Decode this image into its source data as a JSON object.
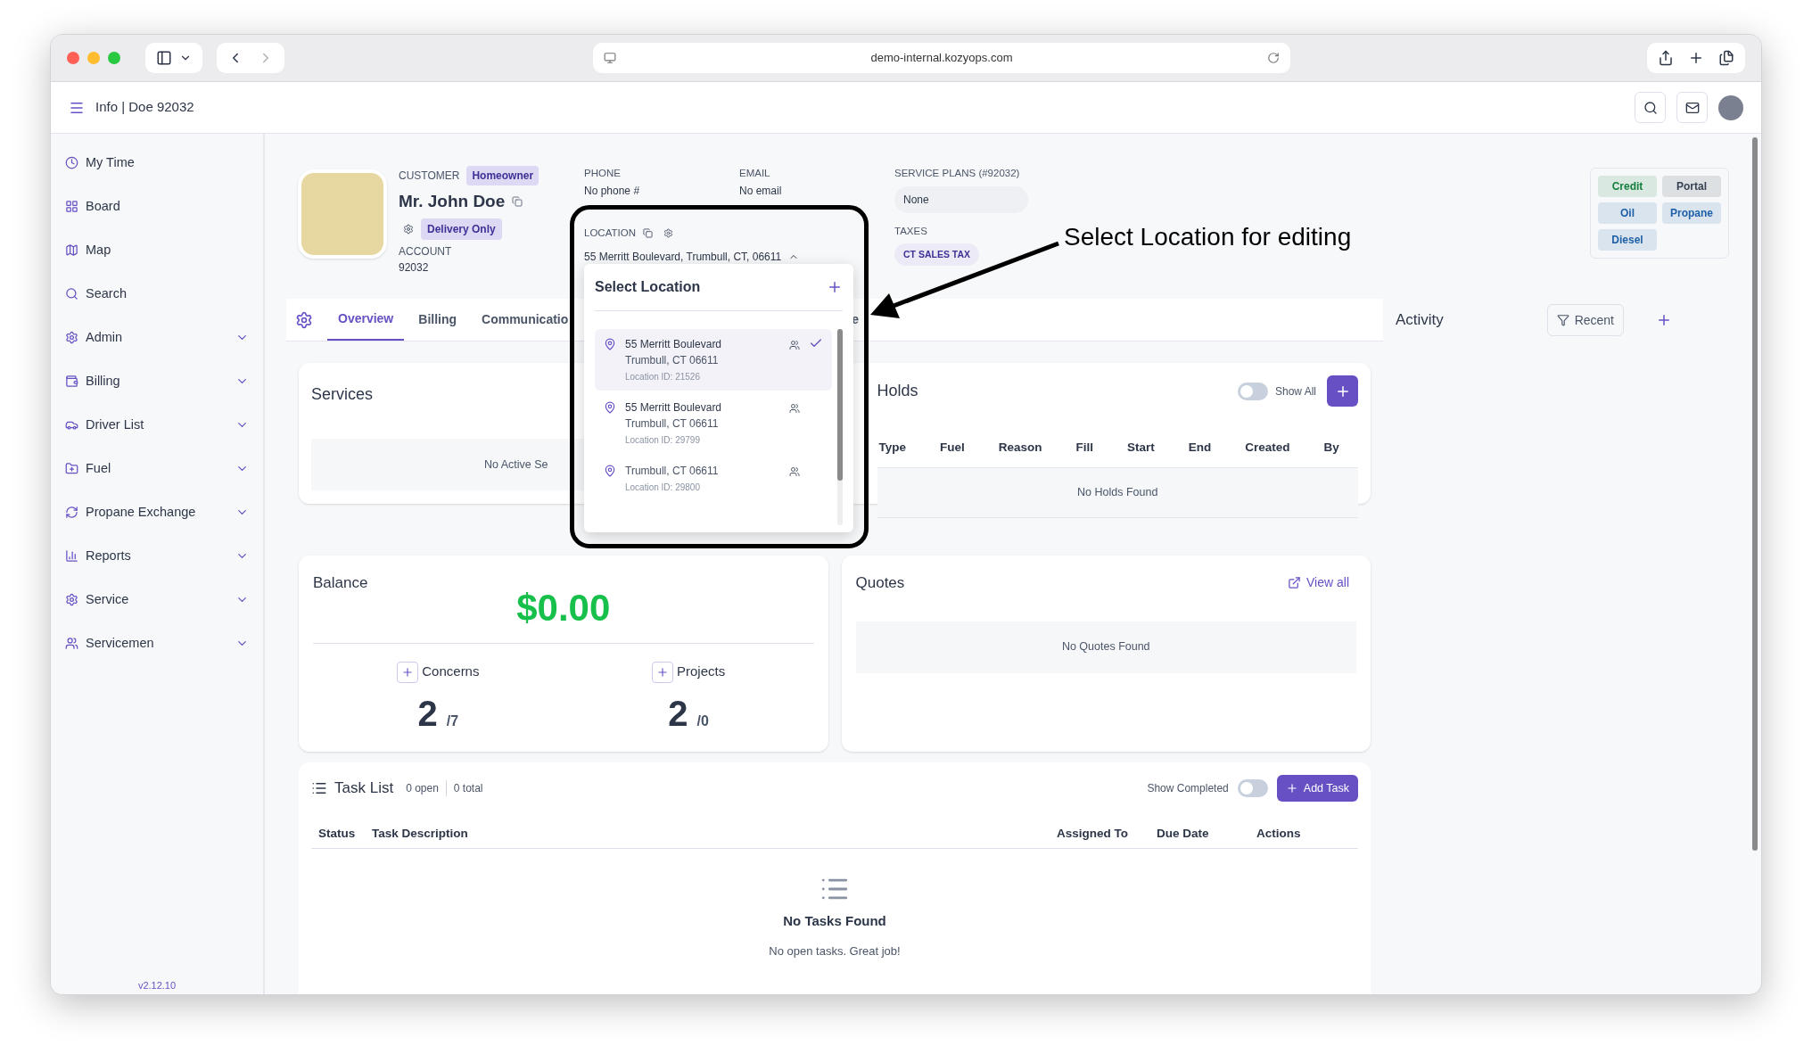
{
  "browser": {
    "url": "demo-internal.kozyops.com"
  },
  "header": {
    "title": "Info | Doe 92032"
  },
  "sidebar": {
    "items": [
      {
        "label": "My Time",
        "has_submenu": false
      },
      {
        "label": "Board",
        "has_submenu": false
      },
      {
        "label": "Map",
        "has_submenu": false
      },
      {
        "label": "Search",
        "has_submenu": false
      },
      {
        "label": "Admin",
        "has_submenu": true
      },
      {
        "label": "Billing",
        "has_submenu": true
      },
      {
        "label": "Driver List",
        "has_submenu": true
      },
      {
        "label": "Fuel",
        "has_submenu": true
      },
      {
        "label": "Propane Exchange",
        "has_submenu": true
      },
      {
        "label": "Reports",
        "has_submenu": true
      },
      {
        "label": "Service",
        "has_submenu": true
      },
      {
        "label": "Servicemen",
        "has_submenu": true
      }
    ],
    "version": "v2.12.10"
  },
  "customer": {
    "label": "CUSTOMER",
    "type_badge": "Homeowner",
    "name": "Mr. John Doe",
    "delivery_badge": "Delivery Only",
    "account_label": "ACCOUNT",
    "account": "92032"
  },
  "phone": {
    "label": "PHONE",
    "value": "No phone #"
  },
  "email": {
    "label": "EMAIL",
    "value": "No email"
  },
  "location": {
    "label": "LOCATION",
    "address": "55 Merritt Boulevard, Trumbull, CT, 06611",
    "expanded": true
  },
  "service_plans": {
    "label": "SERVICE PLANS (#92032)",
    "value": "None"
  },
  "taxes": {
    "label": "TAXES",
    "tags": [
      "CT SALES TAX"
    ]
  },
  "account_tags": [
    {
      "label": "Credit",
      "color": "#15803d"
    },
    {
      "label": "Portal",
      "color": "#374151"
    },
    {
      "label": "Oil",
      "color": "#1e60a8"
    },
    {
      "label": "Propane",
      "color": "#1e60a8"
    },
    {
      "label": "Diesel",
      "color": "#1e60a8"
    }
  ],
  "tabs": [
    {
      "label": "Overview",
      "selected": true
    },
    {
      "label": "Billing",
      "selected": false
    },
    {
      "label": "Communicatio",
      "selected": false
    },
    {
      "label": "e",
      "selected": false
    }
  ],
  "location_dropdown": {
    "title": "Select Location",
    "items": [
      {
        "street": "55 Merritt Boulevard",
        "city": "Trumbull, CT 06611",
        "id": "Location ID: 21526",
        "selected": true
      },
      {
        "street": "55 Merritt Boulevard",
        "city": "Trumbull, CT 06611",
        "id": "Location ID: 29799",
        "selected": false
      },
      {
        "city": "Trumbull, CT 06611",
        "id": "Location ID: 29800",
        "selected": false
      }
    ]
  },
  "services": {
    "title": "Services",
    "empty": "No Active Se"
  },
  "holds": {
    "title": "Holds",
    "show_all": {
      "label": "Show All",
      "on": false
    },
    "columns": [
      "Type",
      "Fuel",
      "Reason",
      "Fill",
      "Start",
      "End",
      "Created",
      "By"
    ],
    "empty": "No Holds Found"
  },
  "balance": {
    "title": "Balance",
    "amount": "$0.00",
    "stats": [
      {
        "label": "Concerns",
        "count": "2",
        "total": "/7"
      },
      {
        "label": "Projects",
        "count": "2",
        "total": "/0"
      }
    ]
  },
  "quotes": {
    "title": "Quotes",
    "link": "View all",
    "empty": "No Quotes Found"
  },
  "task_list": {
    "title": "Task List",
    "open": "0 open",
    "total": "0 total",
    "show_completed": {
      "label": "Show Completed",
      "on": false
    },
    "add_button": "Add Task",
    "columns": [
      "Status",
      "Task Description",
      "Assigned To",
      "Due Date",
      "Actions"
    ],
    "empty_title": "No Tasks Found",
    "empty_text": "No open tasks. Great job!"
  },
  "activity": {
    "title": "Activity",
    "filter": "Recent"
  },
  "annotation": {
    "text": "Select Location for editing"
  }
}
